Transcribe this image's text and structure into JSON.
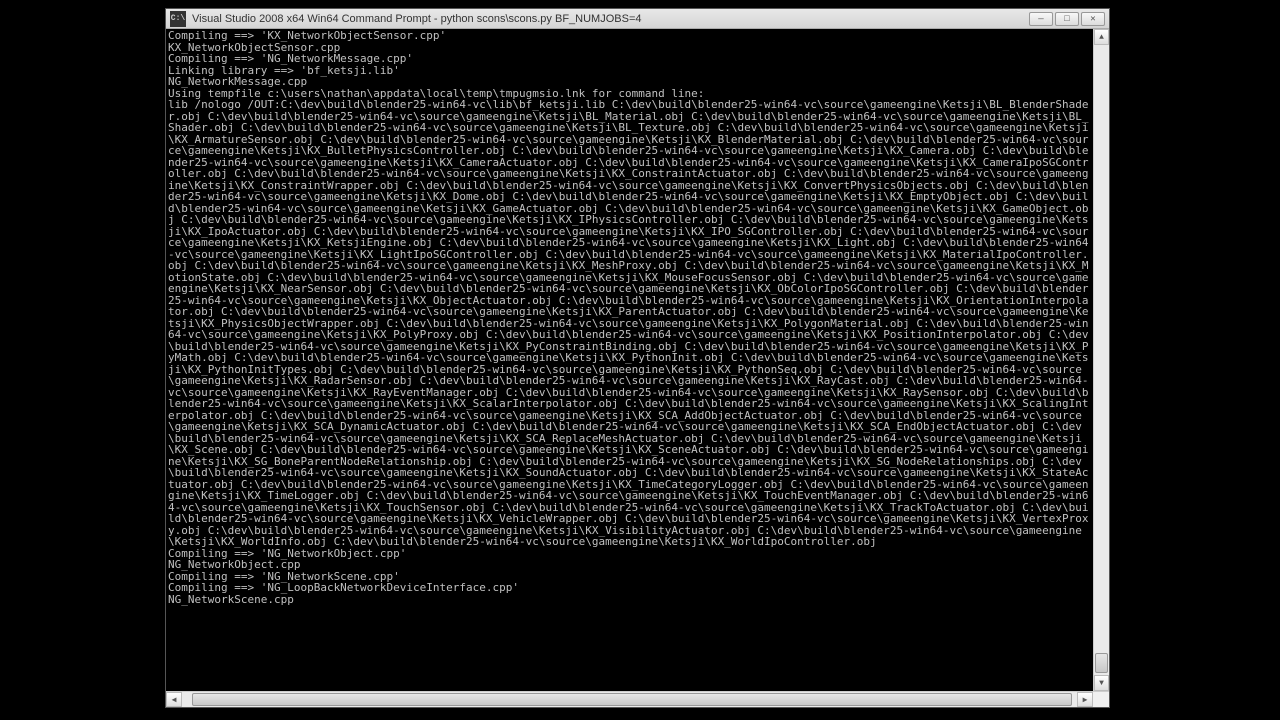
{
  "window": {
    "title": "Visual Studio 2008 x64 Win64 Command Prompt - python  scons\\scons.py BF_NUMJOBS=4",
    "icon_label": "C:\\"
  },
  "console": {
    "text": "Compiling ==> 'KX_NetworkObjectSensor.cpp'\nKX_NetworkObjectSensor.cpp\nCompiling ==> 'NG_NetworkMessage.cpp'\nLinking library ==> 'bf_ketsji.lib'\nNG_NetworkMessage.cpp\nUsing tempfile c:\\users\\nathan\\appdata\\local\\temp\\tmpugmsio.lnk for command line:\nlib /nologo /OUT:C:\\dev\\build\\blender25-win64-vc\\lib\\bf_ketsji.lib C:\\dev\\build\\blender25-win64-vc\\source\\gameengine\\Ketsji\\BL_BlenderShader.obj C:\\dev\\build\\blender25-win64-vc\\source\\gameengine\\Ketsji\\BL_Material.obj C:\\dev\\build\\blender25-win64-vc\\source\\gameengine\\Ketsji\\BL_Shader.obj C:\\dev\\build\\blender25-win64-vc\\source\\gameengine\\Ketsji\\BL_Texture.obj C:\\dev\\build\\blender25-win64-vc\\source\\gameengine\\Ketsji\\KX_ArmatureSensor.obj C:\\dev\\build\\blender25-win64-vc\\source\\gameengine\\Ketsji\\KX_BlenderMaterial.obj C:\\dev\\build\\blender25-win64-vc\\source\\gameengine\\Ketsji\\KX_BulletPhysicsController.obj C:\\dev\\build\\blender25-win64-vc\\source\\gameengine\\Ketsji\\KX_Camera.obj C:\\dev\\build\\blender25-win64-vc\\source\\gameengine\\Ketsji\\KX_CameraActuator.obj C:\\dev\\build\\blender25-win64-vc\\source\\gameengine\\Ketsji\\KX_CameraIpoSGController.obj C:\\dev\\build\\blender25-win64-vc\\source\\gameengine\\Ketsji\\KX_ConstraintActuator.obj C:\\dev\\build\\blender25-win64-vc\\source\\gameengine\\Ketsji\\KX_ConstraintWrapper.obj C:\\dev\\build\\blender25-win64-vc\\source\\gameengine\\Ketsji\\KX_ConvertPhysicsObjects.obj C:\\dev\\build\\blender25-win64-vc\\source\\gameengine\\Ketsji\\KX_Dome.obj C:\\dev\\build\\blender25-win64-vc\\source\\gameengine\\Ketsji\\KX_EmptyObject.obj C:\\dev\\build\\blender25-win64-vc\\source\\gameengine\\Ketsji\\KX_GameActuator.obj C:\\dev\\build\\blender25-win64-vc\\source\\gameengine\\Ketsji\\KX_GameObject.obj C:\\dev\\build\\blender25-win64-vc\\source\\gameengine\\Ketsji\\KX_IPhysicsController.obj C:\\dev\\build\\blender25-win64-vc\\source\\gameengine\\Ketsji\\KX_IpoActuator.obj C:\\dev\\build\\blender25-win64-vc\\source\\gameengine\\Ketsji\\KX_IPO_SGController.obj C:\\dev\\build\\blender25-win64-vc\\source\\gameengine\\Ketsji\\KX_KetsjiEngine.obj C:\\dev\\build\\blender25-win64-vc\\source\\gameengine\\Ketsji\\KX_Light.obj C:\\dev\\build\\blender25-win64-vc\\source\\gameengine\\Ketsji\\KX_LightIpoSGController.obj C:\\dev\\build\\blender25-win64-vc\\source\\gameengine\\Ketsji\\KX_MaterialIpoController.obj C:\\dev\\build\\blender25-win64-vc\\source\\gameengine\\Ketsji\\KX_MeshProxy.obj C:\\dev\\build\\blender25-win64-vc\\source\\gameengine\\Ketsji\\KX_MotionState.obj C:\\dev\\build\\blender25-win64-vc\\source\\gameengine\\Ketsji\\KX_MouseFocusSensor.obj C:\\dev\\build\\blender25-win64-vc\\source\\gameengine\\Ketsji\\KX_NearSensor.obj C:\\dev\\build\\blender25-win64-vc\\source\\gameengine\\Ketsji\\KX_ObColorIpoSGController.obj C:\\dev\\build\\blender25-win64-vc\\source\\gameengine\\Ketsji\\KX_ObjectActuator.obj C:\\dev\\build\\blender25-win64-vc\\source\\gameengine\\Ketsji\\KX_OrientationInterpolator.obj C:\\dev\\build\\blender25-win64-vc\\source\\gameengine\\Ketsji\\KX_ParentActuator.obj C:\\dev\\build\\blender25-win64-vc\\source\\gameengine\\Ketsji\\KX_PhysicsObjectWrapper.obj C:\\dev\\build\\blender25-win64-vc\\source\\gameengine\\Ketsji\\KX_PolygonMaterial.obj C:\\dev\\build\\blender25-win64-vc\\source\\gameengine\\Ketsji\\KX_PolyProxy.obj C:\\dev\\build\\blender25-win64-vc\\source\\gameengine\\Ketsji\\KX_PositionInterpolator.obj C:\\dev\\build\\blender25-win64-vc\\source\\gameengine\\Ketsji\\KX_PyConstraintBinding.obj C:\\dev\\build\\blender25-win64-vc\\source\\gameengine\\Ketsji\\KX_PyMath.obj C:\\dev\\build\\blender25-win64-vc\\source\\gameengine\\Ketsji\\KX_PythonInit.obj C:\\dev\\build\\blender25-win64-vc\\source\\gameengine\\Ketsji\\KX_PythonInitTypes.obj C:\\dev\\build\\blender25-win64-vc\\source\\gameengine\\Ketsji\\KX_PythonSeq.obj C:\\dev\\build\\blender25-win64-vc\\source\\gameengine\\Ketsji\\KX_RadarSensor.obj C:\\dev\\build\\blender25-win64-vc\\source\\gameengine\\Ketsji\\KX_RayCast.obj C:\\dev\\build\\blender25-win64-vc\\source\\gameengine\\Ketsji\\KX_RayEventManager.obj C:\\dev\\build\\blender25-win64-vc\\source\\gameengine\\Ketsji\\KX_RaySensor.obj C:\\dev\\build\\blender25-win64-vc\\source\\gameengine\\Ketsji\\KX_ScalarInterpolator.obj C:\\dev\\build\\blender25-win64-vc\\source\\gameengine\\Ketsji\\KX_ScalingInterpolator.obj C:\\dev\\build\\blender25-win64-vc\\source\\gameengine\\Ketsji\\KX_SCA_AddObjectActuator.obj C:\\dev\\build\\blender25-win64-vc\\source\\gameengine\\Ketsji\\KX_SCA_DynamicActuator.obj C:\\dev\\build\\blender25-win64-vc\\source\\gameengine\\Ketsji\\KX_SCA_EndObjectActuator.obj C:\\dev\\build\\blender25-win64-vc\\source\\gameengine\\Ketsji\\KX_SCA_ReplaceMeshActuator.obj C:\\dev\\build\\blender25-win64-vc\\source\\gameengine\\Ketsji\\KX_Scene.obj C:\\dev\\build\\blender25-win64-vc\\source\\gameengine\\Ketsji\\KX_SceneActuator.obj C:\\dev\\build\\blender25-win64-vc\\source\\gameengine\\Ketsji\\KX_SG_BoneParentNodeRelationship.obj C:\\dev\\build\\blender25-win64-vc\\source\\gameengine\\Ketsji\\KX_SG_NodeRelationships.obj C:\\dev\\build\\blender25-win64-vc\\source\\gameengine\\Ketsji\\KX_SoundActuator.obj C:\\dev\\build\\blender25-win64-vc\\source\\gameengine\\Ketsji\\KX_StateActuator.obj C:\\dev\\build\\blender25-win64-vc\\source\\gameengine\\Ketsji\\KX_TimeCategoryLogger.obj C:\\dev\\build\\blender25-win64-vc\\source\\gameengine\\Ketsji\\KX_TimeLogger.obj C:\\dev\\build\\blender25-win64-vc\\source\\gameengine\\Ketsji\\KX_TouchEventManager.obj C:\\dev\\build\\blender25-win64-vc\\source\\gameengine\\Ketsji\\KX_TouchSensor.obj C:\\dev\\build\\blender25-win64-vc\\source\\gameengine\\Ketsji\\KX_TrackToActuator.obj C:\\dev\\build\\blender25-win64-vc\\source\\gameengine\\Ketsji\\KX_VehicleWrapper.obj C:\\dev\\build\\blender25-win64-vc\\source\\gameengine\\Ketsji\\KX_VertexProxy.obj C:\\dev\\build\\blender25-win64-vc\\source\\gameengine\\Ketsji\\KX_VisibilityActuator.obj C:\\dev\\build\\blender25-win64-vc\\source\\gameengine\\Ketsji\\KX_WorldInfo.obj C:\\dev\\build\\blender25-win64-vc\\source\\gameengine\\Ketsji\\KX_WorldIpoController.obj\nCompiling ==> 'NG_NetworkObject.cpp'\nNG_NetworkObject.cpp\nCompiling ==> 'NG_NetworkScene.cpp'\nCompiling ==> 'NG_LoopBackNetworkDeviceInterface.cpp'\nNG_NetworkScene.cpp"
  }
}
